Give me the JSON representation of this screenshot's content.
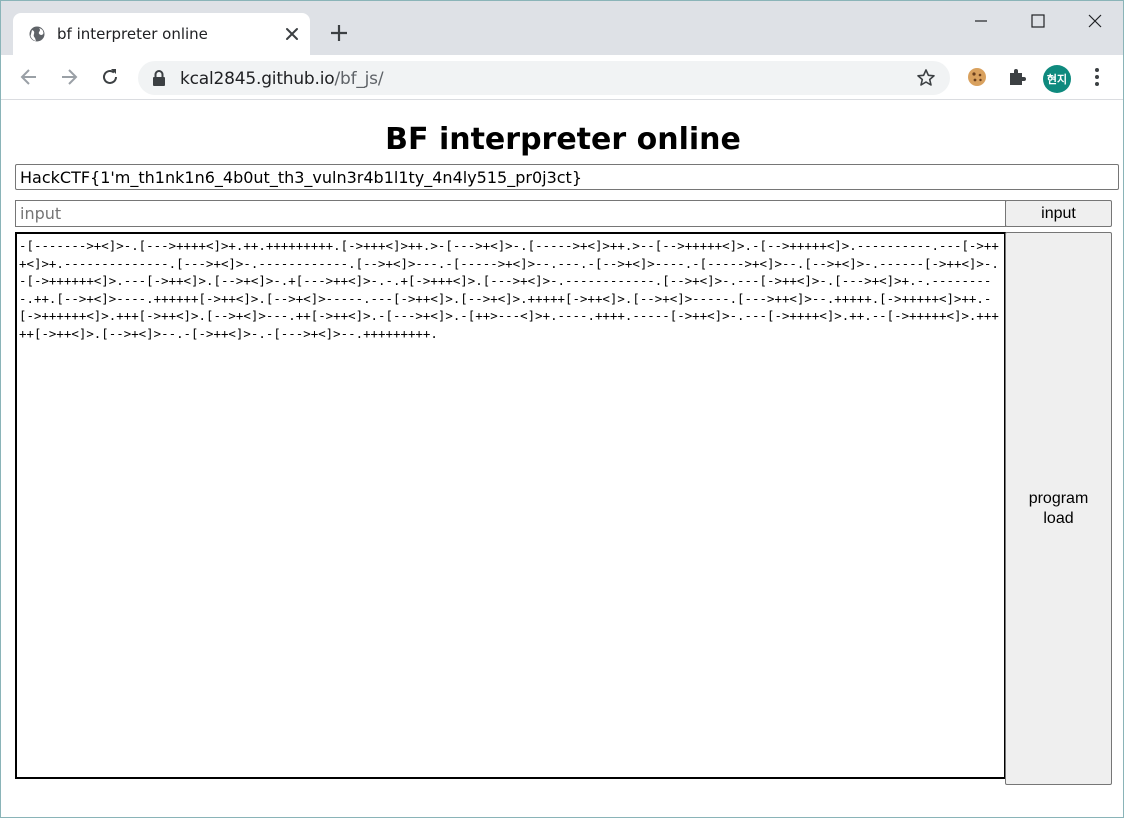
{
  "browser": {
    "tab_title": "bf interpreter online",
    "url_host": "kcal2845.github.io",
    "url_path": "/bf_js/",
    "avatar_text": "현지",
    "icons": [
      "globe-icon",
      "close-icon",
      "plus-icon",
      "minimize-icon",
      "maximize-icon",
      "window-close-icon",
      "back-icon",
      "forward-icon",
      "reload-icon",
      "lock-icon",
      "star-icon",
      "cookie-icon",
      "puzzle-icon",
      "menu-dots-icon"
    ],
    "avatar_color": "#0f8a7e"
  },
  "page": {
    "title": "BF interpreter online",
    "output_value": "HackCTF{1'm_th1nk1n6_4b0ut_th3_vuln3r4b1l1ty_4n4ly515_pr0j3ct}",
    "input_placeholder": "input",
    "input_button_label": "input",
    "load_button_label": "program load",
    "program_code": "-[------->+<]>-.[--->++++<]>+.++.+++++++++.[->+++<]>++.>-[--->+<]>-.[----->+<]>++.>--[-->+++++<]>.-[-->+++++<]>.----------.---[->+++<]>+.--------------.[--->+<]>-.------------.[-->+<]>---.-[----->+<]>--.---.-[-->+<]>----.-[----->+<]>--.[-->+<]>-.------[->++<]>-.-[->++++++<]>.---[->++<]>.[-->+<]>-.+[--->++<]>-.-.+[->+++<]>.[--->+<]>-.------------.[-->+<]>-.---[->++<]>-.[--->+<]>+.-.---------.++.[-->+<]>----.++++++[->++<]>.[-->+<]>-----.---[->++<]>.[-->+<]>.+++++[->++<]>.[-->+<]>-----.[--->++<]>--.+++++.[->+++++<]>++.-[->++++++<]>.+++[->++<]>.[-->+<]>---.++[->++<]>.-[--->+<]>.-[++>---<]>+.----.++++.-----[->++<]>-.---[->++++<]>.++.--[->+++++<]>.+++++[->++<]>.[-->+<]>--.-[->++<]>-.-[--->+<]>--.+++++++++."
  }
}
